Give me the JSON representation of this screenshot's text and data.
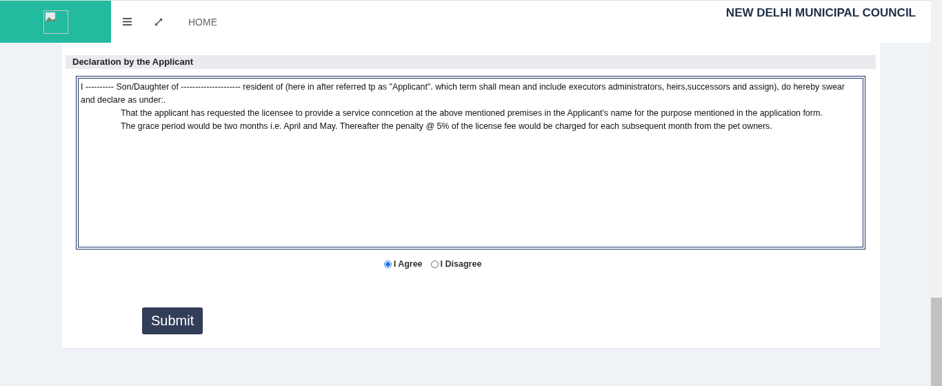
{
  "header": {
    "nav": [
      {
        "kind": "menu"
      },
      {
        "kind": "expand"
      },
      {
        "kind": "link",
        "label": "HOME"
      }
    ],
    "title": "NEW DELHI MUNICIPAL COUNCIL"
  },
  "section": {
    "title": "Declaration by the Applicant",
    "declaration": [
      {
        "kind": "lead",
        "text": "I ---------- Son/Daughter of --------------------- resident of (here in after referred tp as \"Applicant\". which term shall mean and include executors administrators, heirs,successors and assign), do hereby swear and declare as under:."
      },
      {
        "kind": "indent",
        "text": "That the applicant has requested the licensee to provide a service conncetion at the above mentioned premises in the Applicant's name for the purpose mentioned in the application form."
      },
      {
        "kind": "indent",
        "text": "The grace period would be two months i.e. April and May. Thereafter the penalty @ 5% of the license fee would be charged for each subsequent month from the pet owners."
      }
    ],
    "choices": [
      {
        "label": "I Agree",
        "selected": true
      },
      {
        "label": "I Disagree",
        "selected": false
      }
    ],
    "submit": "Submit"
  }
}
